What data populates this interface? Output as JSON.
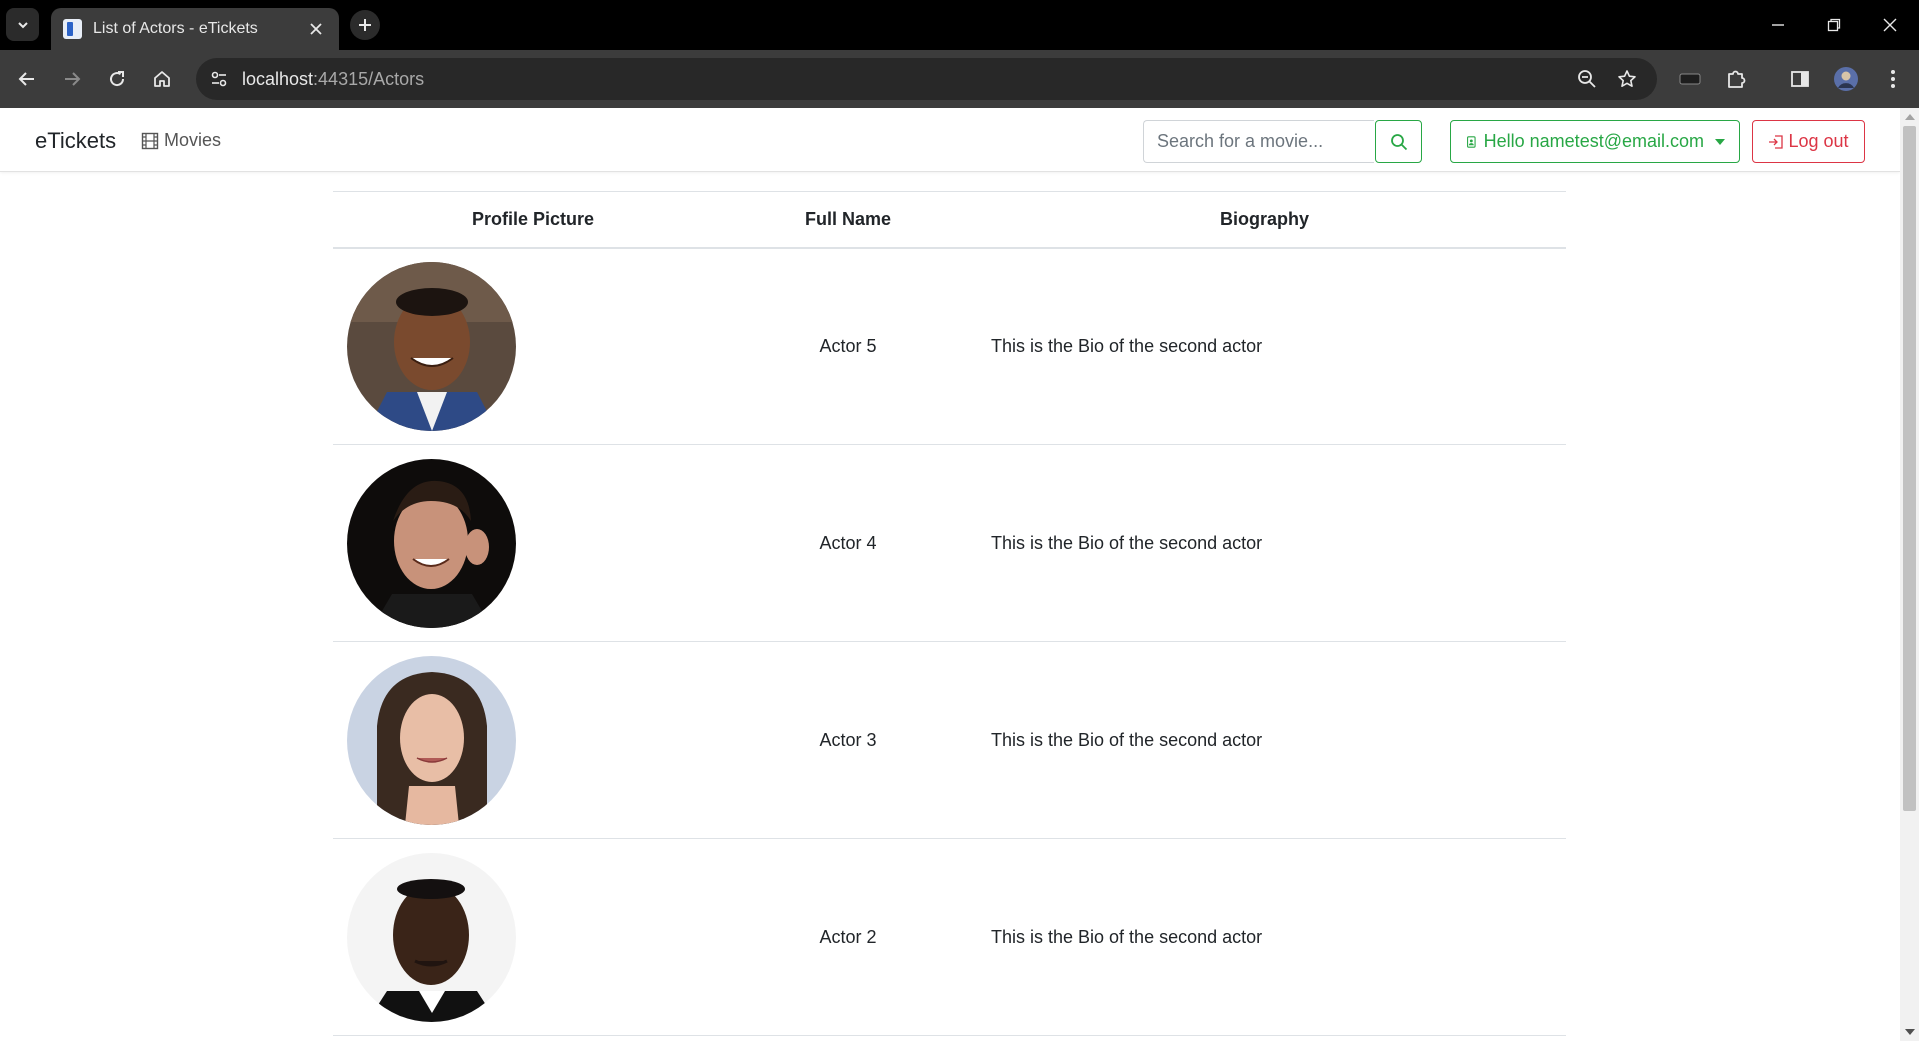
{
  "browser": {
    "tab_title": "List of Actors - eTickets",
    "url_host": "localhost",
    "url_rest": ":44315/Actors"
  },
  "navbar": {
    "brand": "eTickets",
    "movies_label": "Movies",
    "search_placeholder": "Search for a movie...",
    "user_label": "Hello nametest@email.com",
    "logout_label": "Log out",
    "colors": {
      "success": "#28a745",
      "danger": "#dc3545"
    }
  },
  "table": {
    "headers": [
      "Profile Picture",
      "Full Name",
      "Biography"
    ],
    "rows": [
      {
        "name": "Actor 5",
        "bio": "This is the Bio of the second actor",
        "avatar_icon": "actor-photo-icon"
      },
      {
        "name": "Actor 4",
        "bio": "This is the Bio of the second actor",
        "avatar_icon": "actor-photo-icon"
      },
      {
        "name": "Actor 3",
        "bio": "This is the Bio of the second actor",
        "avatar_icon": "actor-photo-icon"
      },
      {
        "name": "Actor 2",
        "bio": "This is the Bio of the second actor",
        "avatar_icon": "actor-photo-icon"
      }
    ]
  }
}
